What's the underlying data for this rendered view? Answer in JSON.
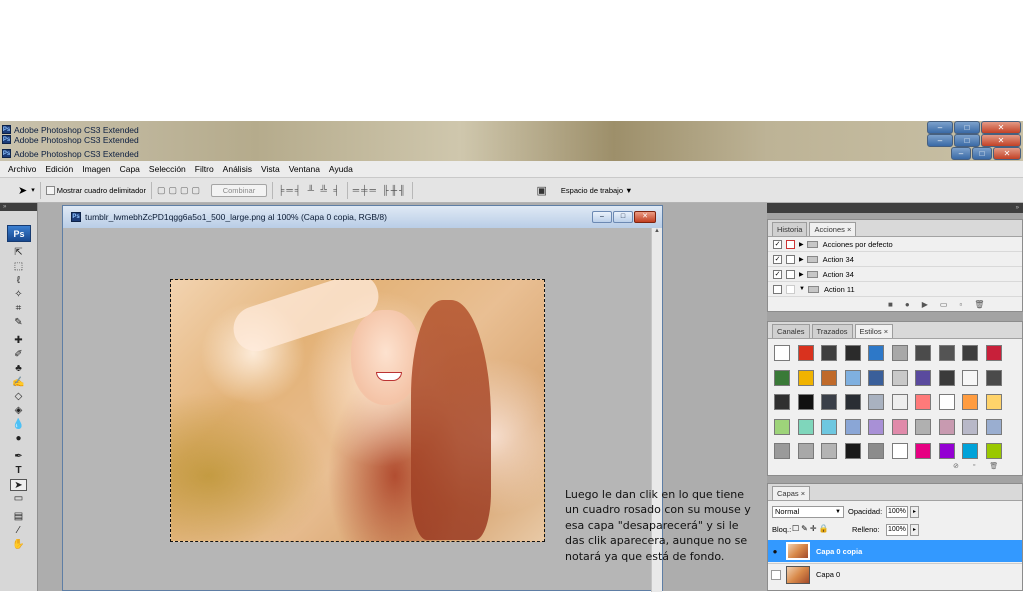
{
  "title_bars": [
    "Adobe Photoshop CS3 Extended",
    "Adobe Photoshop CS3 Extended",
    "Adobe Photoshop CS3 Extended"
  ],
  "menu": [
    "Archivo",
    "Edición",
    "Imagen",
    "Capa",
    "Selección",
    "Filtro",
    "Análisis",
    "Vista",
    "Ventana",
    "Ayuda"
  ],
  "options": {
    "checkbox_label": "Mostrar cuadro delimitador",
    "combinar_label": "Combinar",
    "workspace_label": "Espacio de trabajo ▼"
  },
  "document": {
    "title": "tumblr_lwmebhZcPD1qgg6a5o1_500_large.png al 100% (Capa 0 copia, RGB/8)"
  },
  "history_panel": {
    "tabs": [
      "Historia",
      "Acciones ×"
    ],
    "actions": [
      {
        "label": "Acciones por defecto",
        "checked": "✓"
      },
      {
        "label": "Action 34",
        "checked": "✓"
      },
      {
        "label": "Action 34",
        "checked": "✓"
      },
      {
        "label": "Action 11",
        "checked": ""
      }
    ]
  },
  "styles_panel": {
    "tabs": [
      "Canales",
      "Trazados",
      "Estilos ×"
    ],
    "swatches": [
      [
        "#ffffff",
        "#d9321e",
        "#3f3f3f",
        "#2b2b2b",
        "#2d78c8",
        "#a8a8a8",
        "#4b4b4b",
        "#545454",
        "#3d3d3d",
        "#c8203a"
      ],
      [
        "#3a7a38",
        "#f0b300",
        "#c06a2a",
        "#7fb0e0",
        "#3a5f9a",
        "#c8c8c8",
        "#5a4a9e",
        "#3b3b3b",
        "#f7f7f7",
        "#4a4a4a"
      ],
      [
        "#2f2f2f",
        "#111111",
        "#3a3f48",
        "#2a2e34",
        "#a9b2c0",
        "#eeeeee",
        "#ff7a7a",
        "#ffffff",
        "#ff9c40",
        "#ffd36a"
      ],
      [
        "#9ed47a",
        "#7fd6bb",
        "#6ec7e0",
        "#8aa6d6",
        "#a890d6",
        "#e08aaa",
        "#b0b0b0",
        "#c89ab0",
        "#b8b8c8",
        "#9aaed0"
      ],
      [
        "#9a9a9a",
        "#a8a8a8",
        "#b4b4b4",
        "#1a1a1a",
        "#8c8c8c",
        "#ffffff",
        "#e60082",
        "#9400d3",
        "#00a2d9",
        "#9ac800"
      ]
    ]
  },
  "layers_panel": {
    "tab": "Capas ×",
    "blend_mode": "Normal",
    "opacity_label": "Opacidad:",
    "opacity_value": "100%",
    "lock_label": "Bloq.:",
    "fill_label": "Relleno:",
    "fill_value": "100%",
    "layers": [
      {
        "name": "Capa 0 copia",
        "visible": "●"
      },
      {
        "name": "Capa 0",
        "visible": ""
      }
    ]
  },
  "annotation": "Luego le dan clik en lo que tiene un cuadro rosado con su mouse y esa capa \"desaparecerá\" y si le das clik aparecera, aunque no se notará ya que está de fondo.",
  "colors": {
    "accent": "#3399ff",
    "workspace": "#adadad"
  }
}
